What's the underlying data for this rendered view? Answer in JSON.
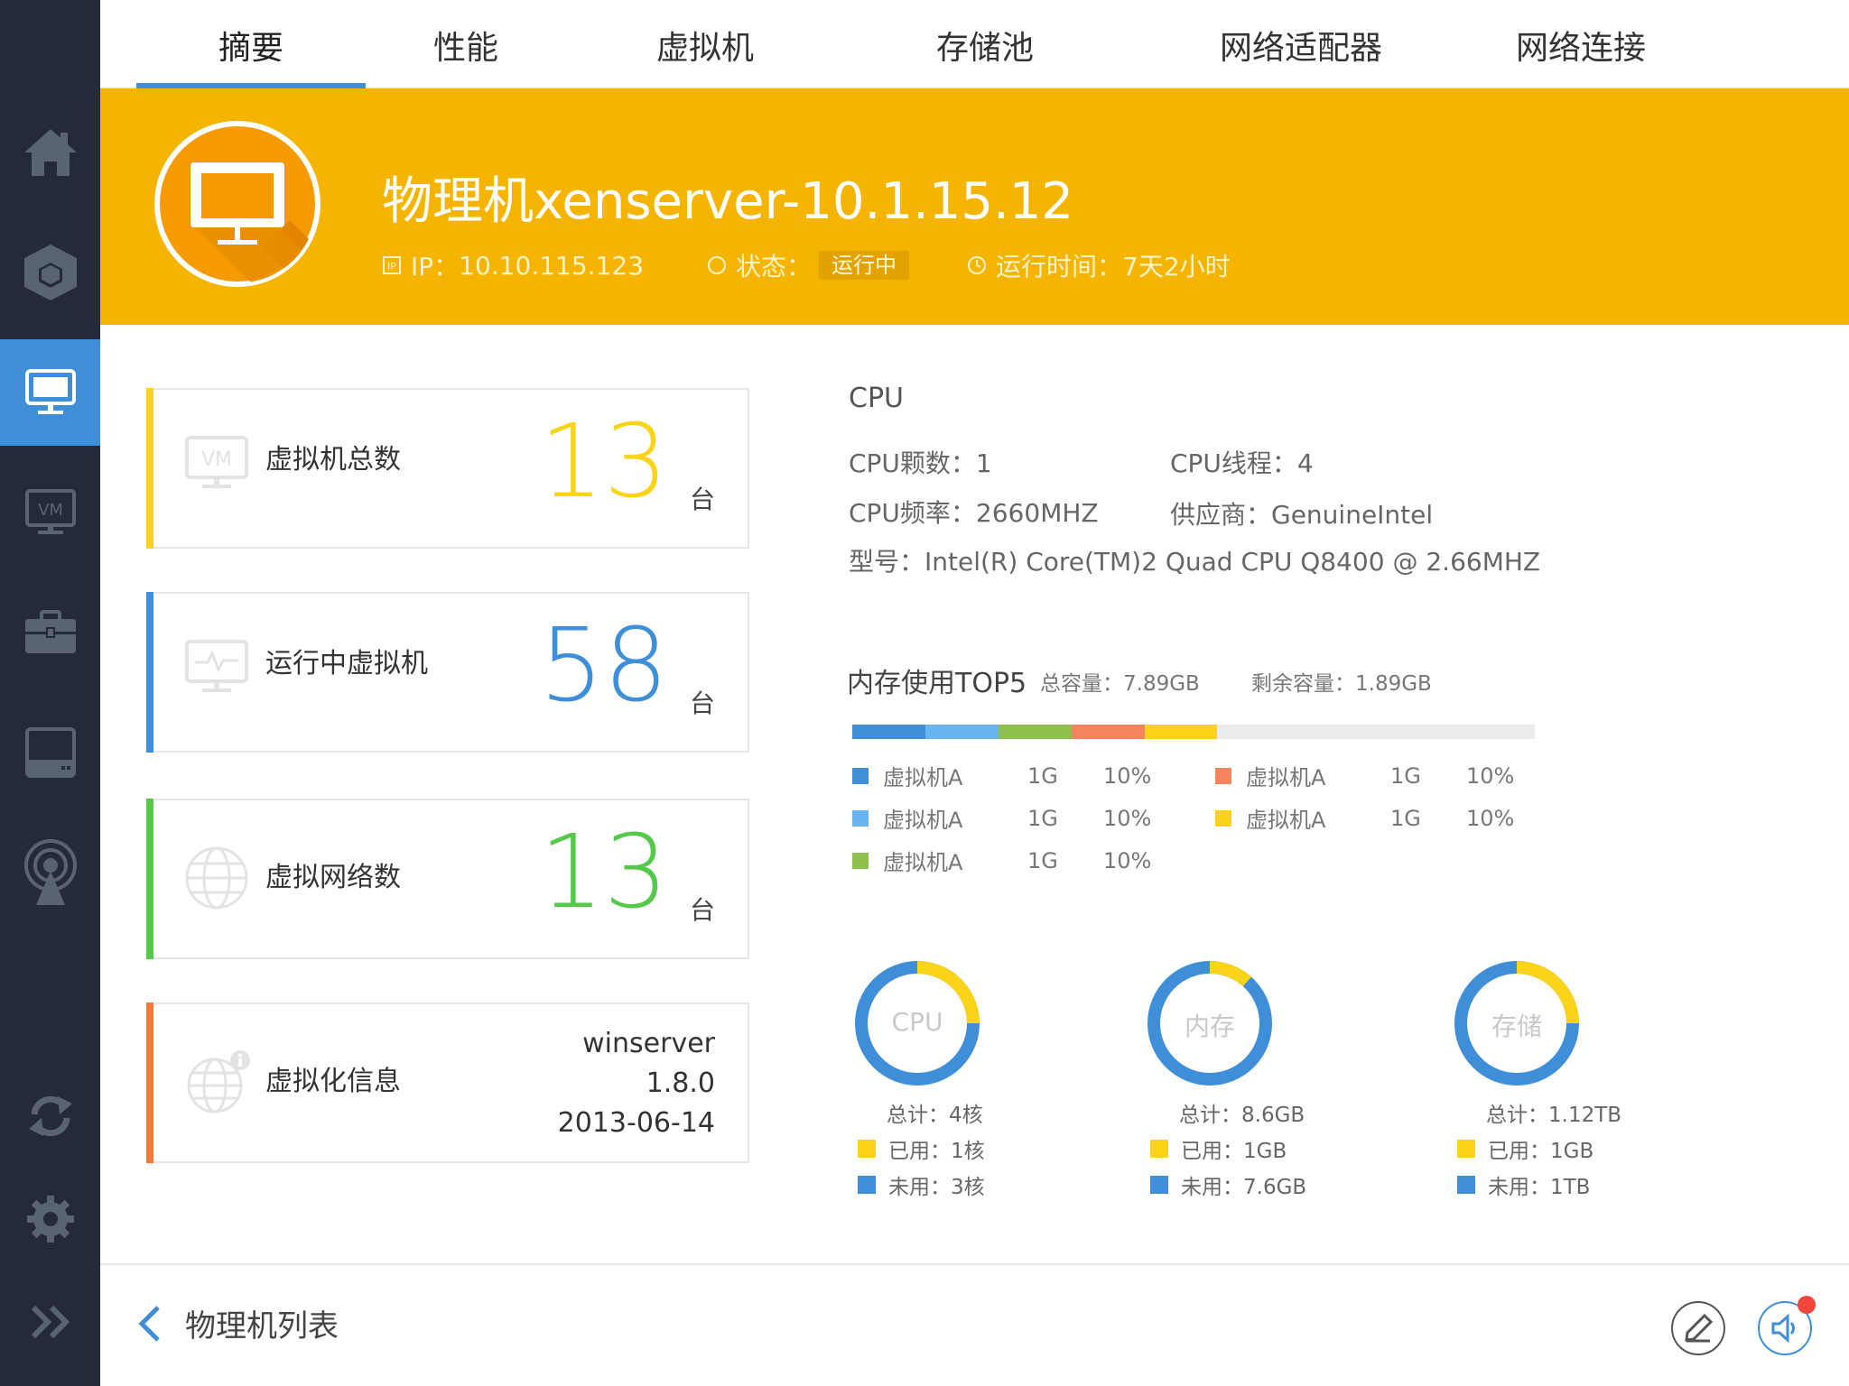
{
  "tabs": [
    "摘要",
    "性能",
    "虚拟机",
    "存储池",
    "网络适配器",
    "网络连接"
  ],
  "header": {
    "title": "物理机xenserver-10.1.15.12",
    "ip_label": "IP：",
    "ip": "10.10.115.123",
    "status_label": "状态：",
    "status": "运行中",
    "uptime_label": "运行时间：",
    "uptime": "7天2小时"
  },
  "cards": {
    "total_vm": {
      "label": "虚拟机总数",
      "value": "13",
      "unit": "台",
      "icon_text": "VM"
    },
    "running_vm": {
      "label": "运行中虚拟机",
      "value": "58",
      "unit": "台"
    },
    "networks": {
      "label": "虚拟网络数",
      "value": "13",
      "unit": "台"
    },
    "virt_info": {
      "label": "虚拟化信息",
      "name": "winserver",
      "version": "1.8.0",
      "date": "2013-06-14"
    }
  },
  "cpu": {
    "title": "CPU",
    "count": "CPU颗数：1",
    "threads": "CPU线程：4",
    "freq": "CPU频率：2660MHZ",
    "vendor": "供应商：GenuineIntel",
    "model": "型号：Intel(R) Core(TM)2 Quad CPU Q8400 @ 2.66MHZ"
  },
  "memory": {
    "title": "内存使用TOP5",
    "total": "总容量：7.89GB",
    "free": "剩余容量：1.89GB",
    "items": [
      {
        "name": "虚拟机A",
        "value": "1G",
        "pct": "10%",
        "fraction": 0.1,
        "color": "#3f8fd8"
      },
      {
        "name": "虚拟机A",
        "value": "1G",
        "pct": "10%",
        "fraction": 0.1,
        "color": "#6ab4f0"
      },
      {
        "name": "虚拟机A",
        "value": "1G",
        "pct": "10%",
        "fraction": 0.1,
        "color": "#8fc14e"
      },
      {
        "name": "虚拟机A",
        "value": "1G",
        "pct": "10%",
        "fraction": 0.1,
        "color": "#f5845e"
      },
      {
        "name": "虚拟机A",
        "value": "1G",
        "pct": "10%",
        "fraction": 0.1,
        "color": "#fbd318"
      }
    ]
  },
  "donuts": [
    {
      "label": "CPU",
      "total": "总计：4核",
      "used": "已用：1核",
      "free": "未用：3核",
      "used_fraction": 0.25
    },
    {
      "label": "内存",
      "total": "总计：8.6GB",
      "used": "已用：1GB",
      "free": "未用：7.6GB",
      "used_fraction": 0.1163
    },
    {
      "label": "存储",
      "total": "总计：1.12TB",
      "used": "已用：1GB",
      "free": "未用：1TB",
      "used_fraction": 0.25
    }
  ],
  "colors": {
    "accent": "#3f8fd8",
    "banner": "#f5b400",
    "sidebar": "#232b3a",
    "yellow": "#fbd318",
    "green": "#55c94a",
    "orange": "#f07a3a"
  },
  "footer": {
    "back_label": "物理机列表"
  },
  "icons": {
    "sidebar": [
      "home-icon",
      "cube-icon",
      "monitor-icon",
      "vm-icon",
      "briefcase-icon",
      "disk-icon",
      "broadcast-icon",
      "refresh-icon",
      "gear-icon",
      "expand-icon"
    ]
  }
}
